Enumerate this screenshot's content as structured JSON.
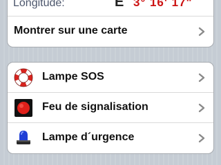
{
  "location": {
    "longitude": {
      "label": "Longitude:",
      "direction": "E",
      "value": "3° 16' 17\""
    },
    "show_on_map": "Montrer sur une carte"
  },
  "lights": {
    "items": [
      {
        "label": "Lampe SOS",
        "icon": "lifebuoy-icon"
      },
      {
        "label": "Feu de signalisation",
        "icon": "red-light-icon"
      },
      {
        "label": "Lampe d´urgence",
        "icon": "beacon-icon"
      }
    ]
  },
  "colors": {
    "background": "#c5ccd4",
    "coordinate_value": "#cc1111",
    "chevron": "#8a8a8a"
  }
}
